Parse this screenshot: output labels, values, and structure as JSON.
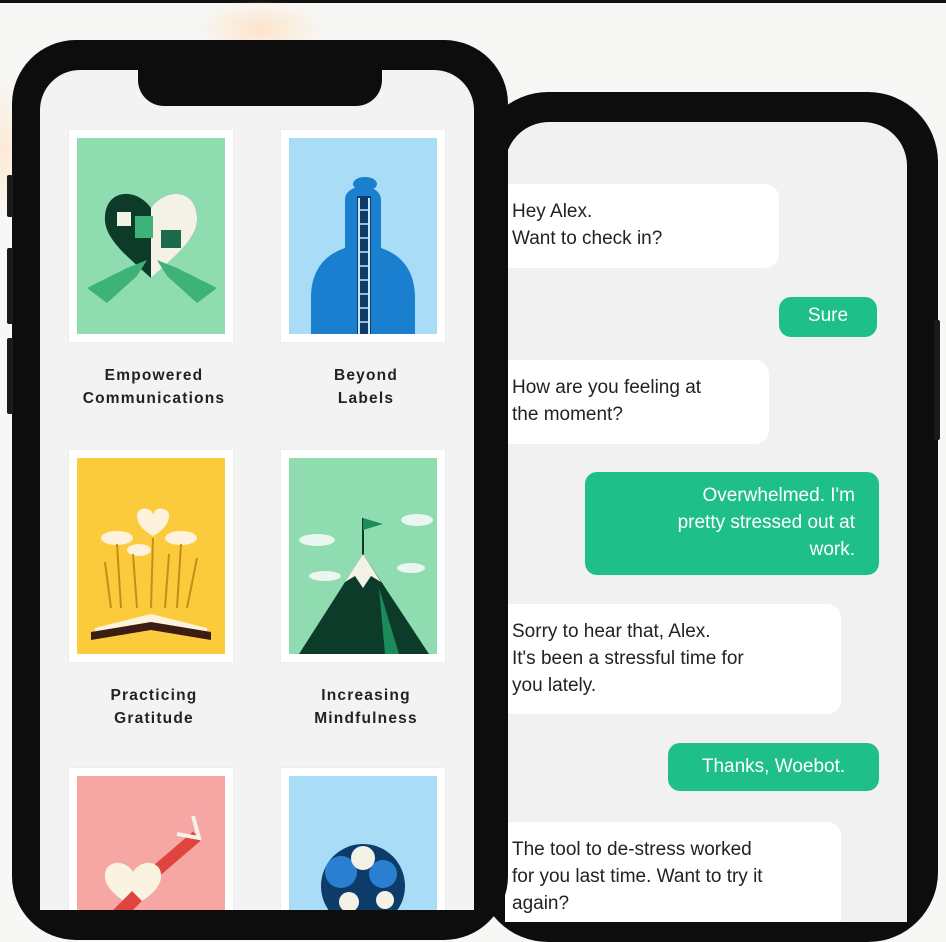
{
  "cards": [
    {
      "title_line1": "Empowered",
      "title_line2": "Communications",
      "art": "heart-hands"
    },
    {
      "title_line1": "Beyond",
      "title_line2": "Labels",
      "art": "head-ladder"
    },
    {
      "title_line1": "Practicing",
      "title_line2": "Gratitude",
      "art": "book-hearts"
    },
    {
      "title_line1": "Increasing",
      "title_line2": "Mindfulness",
      "art": "mountain-flag"
    },
    {
      "title_line1": "",
      "title_line2": "",
      "art": "heart-arrow"
    },
    {
      "title_line1": "",
      "title_line2": "",
      "art": "blue-tree"
    }
  ],
  "chat": [
    {
      "from": "bot",
      "lines": [
        "Hey Alex.",
        "Want to check in?"
      ]
    },
    {
      "from": "user",
      "lines": [
        "Sure"
      ]
    },
    {
      "from": "bot",
      "lines": [
        "How are you feeling at",
        "the moment?"
      ]
    },
    {
      "from": "user",
      "lines": [
        "Overwhelmed. I'm",
        "pretty stressed out at",
        "work."
      ]
    },
    {
      "from": "bot",
      "lines": [
        "Sorry to hear that, Alex.",
        "It's been a stressful time for",
        "you lately."
      ]
    },
    {
      "from": "user",
      "lines": [
        "Thanks, Woebot."
      ]
    },
    {
      "from": "bot",
      "lines": [
        "The tool to de-stress worked",
        "for you last time. Want to try it",
        "again?"
      ]
    }
  ],
  "colors": {
    "accent_green": "#1fbf89",
    "card_green": "#8fdcb1",
    "card_blue": "#a9dcf6",
    "card_yellow": "#fbcb3b",
    "card_pink": "#f7a7a3"
  }
}
